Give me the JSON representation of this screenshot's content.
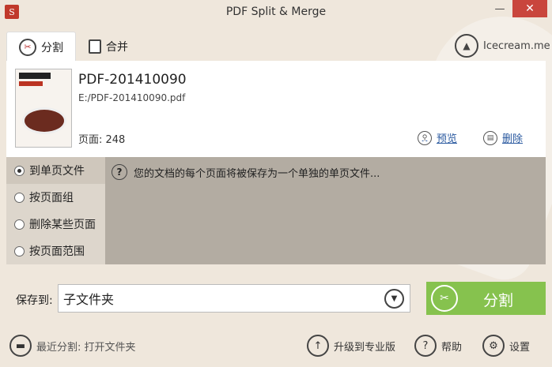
{
  "window": {
    "title": "PDF Split & Merge",
    "app_icon_glyph": "S",
    "minimize_glyph": "—",
    "close_glyph": "✕"
  },
  "tabs": [
    {
      "label": "分割",
      "icon": "scissors-icon",
      "active": true
    },
    {
      "label": "合并",
      "icon": "document-icon",
      "active": false
    }
  ],
  "brand": {
    "label": "Icecream.me",
    "icon": "icecream-logo"
  },
  "file": {
    "name": "PDF-201410090",
    "path": "E:/PDF-201410090.pdf",
    "pages": "页面: 248",
    "preview_label": "预览",
    "delete_label": "删除"
  },
  "split_modes": [
    {
      "label": "到单页文件",
      "selected": true
    },
    {
      "label": "按页面组",
      "selected": false
    },
    {
      "label": "删除某些页面",
      "selected": false
    },
    {
      "label": "按页面范围",
      "selected": false
    }
  ],
  "hint": {
    "text": "您的文档的每个页面将被保存为一个单独的单页文件..."
  },
  "save": {
    "label": "保存到:",
    "value": "子文件夹"
  },
  "split_button": {
    "label": "分割"
  },
  "footer": {
    "recent": "最近分割: 打开文件夹",
    "upgrade": "升级到专业版",
    "help": "帮助",
    "settings": "设置"
  },
  "colors": {
    "background": "#efe7dc",
    "accent_green": "#86c24e",
    "close_red": "#c9463d",
    "link_blue": "#2b5aa0"
  }
}
